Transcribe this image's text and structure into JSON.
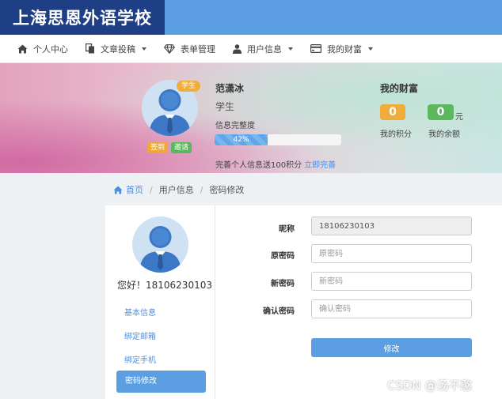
{
  "site": {
    "logo_text": "上海思恩外语学校"
  },
  "nav": {
    "items": [
      {
        "label": "个人中心",
        "icon": "home-icon",
        "dropdown": false
      },
      {
        "label": "文章投稿",
        "icon": "copy-icon",
        "dropdown": true
      },
      {
        "label": "表单管理",
        "icon": "diamond-icon",
        "dropdown": false
      },
      {
        "label": "用户信息",
        "icon": "user-icon",
        "dropdown": true
      },
      {
        "label": "我的财富",
        "icon": "credit-card-icon",
        "dropdown": true
      }
    ]
  },
  "profile": {
    "badge": "学生",
    "name": "范潇冰",
    "role": "学生",
    "completeness_label": "信息完整度",
    "completeness_percent": 42,
    "completeness_text": "42%",
    "sign_in_label": "签到",
    "invite_label": "邀请",
    "promo_text": "完善个人信息送100积分",
    "promo_link": "立即完善"
  },
  "wealth": {
    "title": "我的财富",
    "points_value": "0",
    "points_label": "我的积分",
    "balance_value": "0",
    "balance_unit": "元",
    "balance_label": "我的余额"
  },
  "breadcrumb": {
    "home": "首页",
    "section": "用户信息",
    "current": "密码修改"
  },
  "sidebar": {
    "greeting": "您好！18106230103",
    "items": [
      {
        "label": "基本信息"
      },
      {
        "label": "绑定邮箱"
      },
      {
        "label": "绑定手机"
      },
      {
        "label": "密码修改"
      }
    ],
    "active_index": 3
  },
  "form": {
    "nickname_label": "昵称",
    "nickname_value": "18106230103",
    "old_password_label": "原密码",
    "old_password_placeholder": "原密码",
    "new_password_label": "新密码",
    "new_password_placeholder": "新密码",
    "confirm_password_label": "确认密码",
    "confirm_password_placeholder": "确认密码",
    "submit_label": "修改"
  },
  "watermark": "CSDN @汤不憨",
  "colors": {
    "primary": "#5b9fe2",
    "logo_bg": "#1e3f86",
    "orange": "#f0ad3c",
    "green": "#5cb85c"
  }
}
